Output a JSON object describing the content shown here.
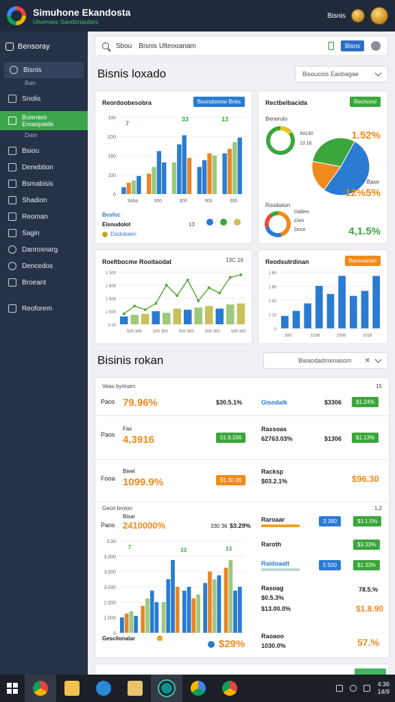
{
  "app": {
    "title": "Simuhone Ekandosta",
    "subtitle": "Ulvenses Sandonaubes",
    "user_label": "Bisnis"
  },
  "sidebar": {
    "brand": "Bensoray",
    "items": [
      {
        "label": "Bisnis",
        "sub": "Ban"
      },
      {
        "label": "Snolis",
        "sub": ""
      },
      {
        "label": "Buisnass Eroaopaide",
        "sub": "Dain",
        "active": true
      },
      {
        "label": "Bsiou",
        "sub": ""
      },
      {
        "label": "Denebtion",
        "sub": ""
      },
      {
        "label": "Bsmabisis",
        "sub": ""
      },
      {
        "label": "Shadion",
        "sub": ""
      },
      {
        "label": "Reoman",
        "sub": ""
      },
      {
        "label": "Sagin",
        "sub": ""
      },
      {
        "label": "Danroxnarg",
        "sub": ""
      },
      {
        "label": "Dencedos",
        "sub": ""
      },
      {
        "label": "Broeant",
        "sub": ""
      },
      {
        "label": "Reoforem",
        "sub": ""
      }
    ]
  },
  "search": {
    "label": "Sbou",
    "value": "Bisnis Ulteooanam",
    "button": "Bisns"
  },
  "section1": {
    "title": "Bisnis loxado",
    "dropdown": "Bisoucios Eaobagae"
  },
  "card_bar": {
    "title": "Reordoobesobra",
    "pill": "Boondonme Bnks",
    "yticks": [
      "100",
      "1D0",
      "160",
      "100",
      "0"
    ],
    "xticks": [
      "3oba",
      "300",
      "300",
      "300",
      "300"
    ],
    "peak_labels": [
      "7",
      "33",
      "13"
    ],
    "legend_title": "Besfoc",
    "legend_value": "Eisnudolot",
    "legend_sub": "Eisdobaen",
    "legend_count": "13"
  },
  "card_pie": {
    "title": "Rectbelbacida",
    "pill": "Rechcesl",
    "top_label": "Benerulo",
    "pie_labels": [
      "50130",
      "13 16"
    ],
    "pct1": "1.52%",
    "pct1_label": "Baxe",
    "pct2": "12%5%",
    "bottom_label": "Rouibaion",
    "donut_labels": [
      "Daibes",
      "Clen",
      "Doce"
    ],
    "pct3": "4,1.5%"
  },
  "card_line": {
    "title": "Roefibocme Rooitaodat",
    "badge": "13C 16",
    "yticks": [
      "1 300",
      "1 500",
      "1 500",
      "1 500",
      "3.10"
    ],
    "xticks": [
      "500 306",
      "500 300",
      "500 300",
      "500 300",
      "500 300"
    ],
    "pill": ""
  },
  "card_bar2": {
    "title": "Reodsutrdinan",
    "pill": "Bansoanen",
    "yticks": [
      "1 80",
      "1 80",
      "1 50",
      "1 10",
      "0"
    ],
    "xticks": [
      "300",
      "1036",
      "1008",
      "1018"
    ]
  },
  "section2": {
    "title": "Bisinis rokan",
    "dropdown": "Bieaodadmenasom"
  },
  "list": {
    "header": "Veas byrinam",
    "header_right": "15",
    "rows": [
      {
        "label": "Paos",
        "value": "79.96%",
        "mid": "$30.5.1%",
        "name": "Gisodalk",
        "amount": "$3306",
        "pill": "$1.24%"
      },
      {
        "label": "Paos",
        "sub": "Fax",
        "value": "4,3916",
        "mid_pill": "01.9.336",
        "name": "Rassoas",
        "name_sub": "62763.03%",
        "amount": "$1306",
        "pill": "$1.13%"
      },
      {
        "label": "Fooa",
        "sub": "Bieel",
        "value": "1099.9%",
        "mid_pill": "91.30.36",
        "name": "Racksp",
        "name_sub": "$03.2.1%",
        "amount": "$96.30"
      }
    ],
    "sub_header": "Geon broion",
    "sub_header_right": "1,2",
    "row4": {
      "label": "Paos",
      "sub": "Bisar",
      "value": "2410000%",
      "badge": "330 36",
      "mid": "$3.29%"
    },
    "chart_yticks": [
      "3.00",
      "3,000",
      "3,000",
      "3,000",
      "2.000",
      "1.000",
      "0"
    ],
    "chart_peaks": [
      "7",
      "33",
      "13"
    ],
    "chart_footer": "Gescilonalar",
    "chart_footer_pct": "$29%",
    "right_rows": [
      {
        "name": "Raroaar",
        "pill_blue": "3 390",
        "pill_green": "$3.1.5%"
      },
      {
        "name": "Raroth",
        "pill_green": "$3.33%"
      },
      {
        "name": "Raidoaatt",
        "pill_blue": "5 500",
        "pill_green": "$1.33%"
      },
      {
        "name": "Rasoag",
        "sub": "$0.5.3%",
        "amount": "78.5.%"
      },
      {
        "name": "",
        "sub": "$13.00.0%",
        "amount": "$1.8.90"
      },
      {
        "name": "Raoaoo",
        "sub": "1030.0%",
        "amount": "57.%"
      }
    ]
  },
  "taskbar": {
    "time": "4:36",
    "date": "14/9"
  },
  "colors": {
    "blue": "#2a7bd1",
    "green": "#3ba63c",
    "orange": "#f08a1c",
    "lightgreen": "#9cc97a",
    "sidebar": "#253247",
    "header": "#1f2a3c"
  },
  "chart_data": [
    {
      "type": "bar",
      "title": "Reordoobesobra",
      "categories": [
        "3oba",
        "300",
        "300",
        "300",
        "300"
      ],
      "series": [
        {
          "values": [
            15,
            45,
            70,
            60,
            90
          ]
        },
        {
          "values": [
            25,
            60,
            110,
            75,
            100
          ]
        },
        {
          "values": [
            30,
            95,
            130,
            90,
            115
          ]
        },
        {
          "values": [
            40,
            70,
            80,
            85,
            125
          ]
        }
      ],
      "ylim": [
        0,
        170
      ]
    },
    {
      "type": "pie",
      "title": "Rectbelbacida",
      "values": [
        52,
        18,
        30
      ],
      "labels": [
        "blue",
        "orange",
        "green"
      ]
    },
    {
      "type": "line",
      "title": "Roefibocme Rooitaodat",
      "x": [
        1,
        2,
        3,
        4,
        5,
        6,
        7,
        8,
        9,
        10,
        11,
        12
      ],
      "values": [
        20,
        35,
        28,
        40,
        75,
        55,
        85,
        45,
        70,
        60,
        90,
        95
      ],
      "bars": [
        15,
        18,
        20,
        25,
        22,
        30,
        28,
        32,
        35,
        30,
        38,
        40
      ]
    },
    {
      "type": "bar",
      "title": "Reodsutrdinan",
      "categories": [
        "300",
        "1036",
        "1008",
        "1018"
      ],
      "values": [
        20,
        28,
        40,
        68,
        55,
        84,
        52,
        60,
        84
      ]
    },
    {
      "type": "bar",
      "title": "Geon broion",
      "series": [
        {
          "values": [
            20,
            35,
            40,
            55,
            65,
            85
          ]
        },
        {
          "values": [
            25,
            45,
            70,
            60,
            80,
            95
          ]
        },
        {
          "values": [
            28,
            55,
            95,
            45,
            70,
            55
          ]
        },
        {
          "values": [
            22,
            40,
            60,
            50,
            75,
            60
          ]
        }
      ],
      "ylim": [
        0,
        120
      ]
    }
  ]
}
